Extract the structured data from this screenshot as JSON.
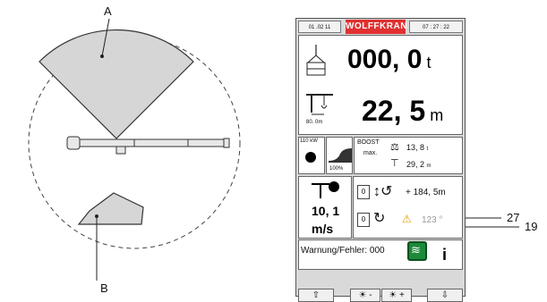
{
  "diagram": {
    "label_a": "A",
    "label_b": "B",
    "colors": {
      "sector_fill": "#d6d6d6",
      "outline": "#333333"
    }
  },
  "panel": {
    "date": "01 .02 11",
    "brand": "WOLFFKRAN",
    "time": "07 : 27 : 22",
    "load_value": "000, 0",
    "load_unit": "t",
    "radius_value": "22, 5",
    "radius_unit": "m",
    "hook_distance": "80. 0m",
    "power": "110 kW",
    "speed_percent": "100%",
    "boost_label": "BOOST",
    "boost_max": "max.",
    "boost_load": "13, 8",
    "boost_load_unit": "t",
    "boost_radius": "29, 2",
    "boost_radius_unit": "m",
    "wind_value": "10, 1",
    "wind_unit": "m/s",
    "trolley_counter": "0",
    "trolley_value": "+ 184, 5",
    "trolley_unit": "m",
    "slew_counter": "0",
    "slew_value": "123 °",
    "warning_text": "Warnung/Fehler: 000",
    "info_symbol": "i",
    "footer": {
      "up": "⇧",
      "dim": "☀ -",
      "bright": "☀ +",
      "down": "⇩"
    },
    "brand_color": "#e03030",
    "wifi_color": "#1c8a3a"
  },
  "callouts": {
    "c27": "27",
    "c19": "19"
  }
}
